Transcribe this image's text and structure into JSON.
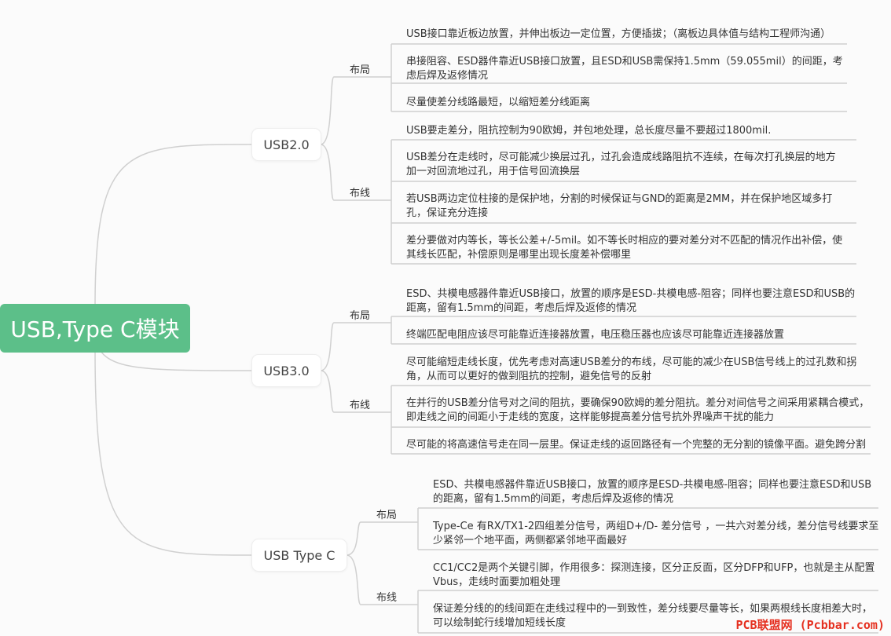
{
  "root": {
    "label": "USB,Type C模块"
  },
  "branches": [
    {
      "label": "USB2.0",
      "groups": [
        {
          "label": "布局",
          "items": [
            [
              "USB接口靠近板边放置，并伸出板边一定位置，方便插拔；（离板边具体值与结构工程师沟通）"
            ],
            [
              "串接阻容、ESD器件靠近USB接口放置，且ESD和USB需保持1.5mm（59.055mil）的间距，考",
              "虑后焊及返修情况"
            ],
            [
              "尽量使差分线路最短，以缩短差分线距离"
            ]
          ]
        },
        {
          "label": "布线",
          "items": [
            [
              "USB要走差分，阻抗控制为90欧姆，并包地处理，总长度尽量不要超过1800mil."
            ],
            [
              "USB差分在走线时，尽可能减少换层过孔，过孔会造成线路阻抗不连续，在每次打孔换层的地方",
              "加一对回流地过孔，用于信号回流换层"
            ],
            [
              "若USB两边定位柱接的是保护地，分割的时候保证与GND的距离是2MM，并在保护地区域多打",
              "孔，保证充分连接"
            ],
            [
              "差分要做对内等长，等长公差+/-5mil。如不等长时相应的要对差分对不匹配的情况作出补偿，使",
              "其线长匹配，补偿原则是哪里出现长度差补偿哪里"
            ]
          ]
        }
      ]
    },
    {
      "label": "USB3.0",
      "groups": [
        {
          "label": "布局",
          "items": [
            [
              "ESD、共模电感器件靠近USB接口，放置的顺序是ESD-共模电感-阻容；同样也要注意ESD和USB的",
              "距离，留有1.5mm的间距，考虑后焊及返修的情况"
            ],
            [
              "终端匹配电阻应该尽可能靠近连接器放置，电压稳压器也应该尽可能靠近连接器放置"
            ]
          ]
        },
        {
          "label": "布线",
          "items": [
            [
              "尽可能缩短走线长度，优先考虑对高速USB差分的布线，尽可能的减少在USB信号线上的过孔数和拐",
              "角，从而可以更好的做到阻抗的控制，避免信号的反射"
            ],
            [
              "在并行的USB差分信号对之间的阻抗，要确保90欧姆的差分阻抗。差分对间信号之间采用紧耦合模式，",
              "即走线之间的间距小于走线的宽度，这样能够提高差分信号抗外界噪声干扰的能力"
            ],
            [
              "尽可能的将高速信号走在同一层里。保证走线的返回路径有一个完整的无分割的镜像平面。避免跨分割"
            ]
          ]
        }
      ]
    },
    {
      "label": "USB Type C",
      "groups": [
        {
          "label": "布局",
          "items": [
            [
              "ESD、共模电感器件靠近USB接口，放置的顺序是ESD-共模电感-阻容；同样也要注意ESD和USB",
              "的距离，留有1.5mm的间距，考虑后焊及返修的情况"
            ],
            [
              "Type-Ce 有RX/TX1-2四组差分信号，两组D+/D- 差分信号 ，一共六对差分线，差分信号线要求至",
              "少紧邻一个地平面，两侧都紧邻地平面最好"
            ]
          ]
        },
        {
          "label": "布线",
          "items": [
            [
              "CC1/CC2是两个关键引脚，作用很多：探测连接，区分正反面，区分DFP和UFP，也就是主从配置",
              "Vbus，走线时面要加粗处理"
            ],
            [
              "保证差分线的的线间距在走线过程中的一到致性，差分线要尽量等长，如果两根线长度相差大时，",
              "可以绘制蛇行线增加短线长度"
            ]
          ]
        }
      ]
    }
  ],
  "watermark": "PCB联盟网 (Pcbbar.com)"
}
